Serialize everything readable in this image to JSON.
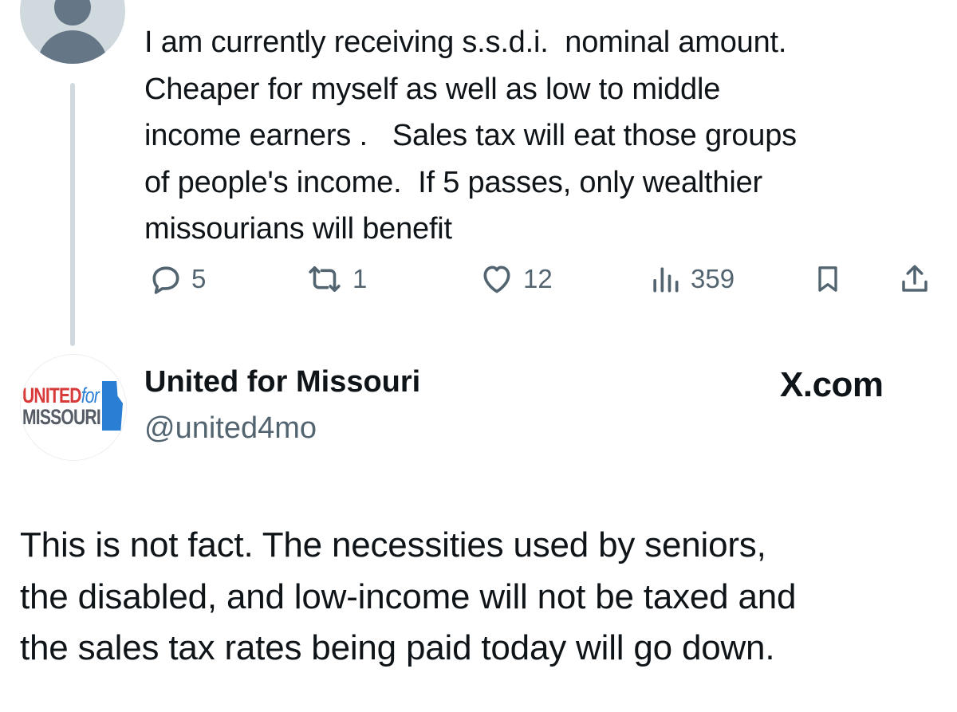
{
  "top_tweet": {
    "avatar": "default-avatar",
    "text": "I am currently receiving s.s.d.i.  nominal amount.\nCheaper for myself as well as low to middle\nincome earners .   Sales tax will eat those groups\nof people's income.  If 5 passes, only wealthier\nmissourians will benefit",
    "actions": {
      "replies": "5",
      "reposts": "1",
      "likes": "12",
      "views": "359"
    },
    "icons": [
      "reply-icon",
      "repost-icon",
      "like-icon",
      "views-icon",
      "bookmark-icon",
      "share-icon"
    ]
  },
  "reply_tweet": {
    "avatar_logo": {
      "line1": "UNITED",
      "line1_suffix": "for",
      "line2": "MISSOURI"
    },
    "display_name": "United for Missouri",
    "handle": "@united4mo",
    "watermark": "X.com",
    "text": "This is not fact. The necessities used by seniors,\nthe disabled, and low-income will not be taxed and\nthe sales tax rates being paid today will go down."
  },
  "colors": {
    "text": "#0f1419",
    "secondary": "#536471",
    "avatar_bg": "#cfd9de",
    "logo_red": "#d83a3a",
    "logo_blue": "#2a7fd4"
  }
}
